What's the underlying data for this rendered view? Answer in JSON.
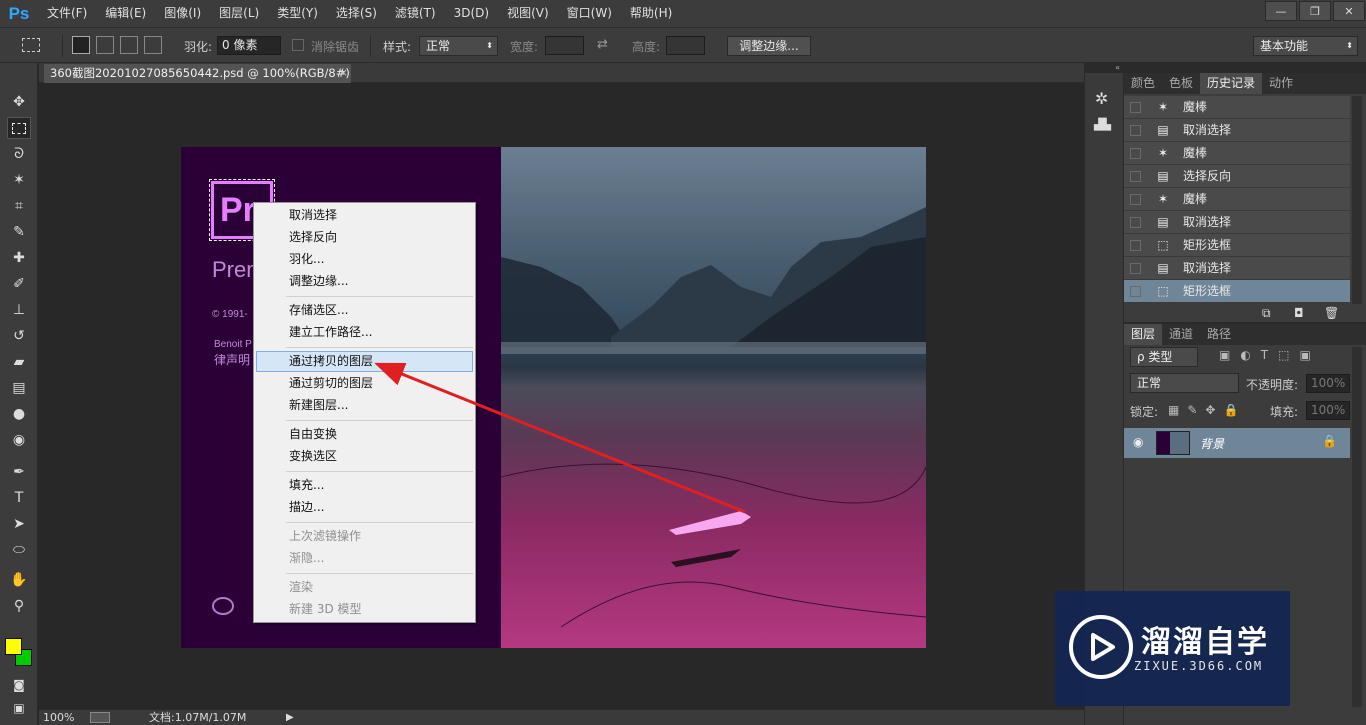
{
  "app": {
    "logo": "Ps"
  },
  "menu": [
    "文件(F)",
    "编辑(E)",
    "图像(I)",
    "图层(L)",
    "类型(Y)",
    "选择(S)",
    "滤镜(T)",
    "3D(D)",
    "视图(V)",
    "窗口(W)",
    "帮助(H)"
  ],
  "window_buttons": {
    "minimize": "—",
    "restore": "❐",
    "close": "✕"
  },
  "options": {
    "feather_label": "羽化:",
    "feather_value": "0 像素",
    "antialias_label": "消除锯齿",
    "style_label": "样式:",
    "style_value": "正常",
    "width_label": "宽度:",
    "height_label": "高度:",
    "refine_button": "调整边缘...",
    "workspace": "基本功能"
  },
  "document": {
    "tab_title": "360截图20201027085650442.psd @ 100%(RGB/8#)",
    "close": "×"
  },
  "splash": {
    "logo_text": "Pr",
    "product": "Prem",
    "copyright": "© 1991-",
    "credit1": "Benoit P",
    "credit2": "律声明"
  },
  "context_menu": {
    "items": [
      {
        "label": "取消选择",
        "disabled": false
      },
      {
        "label": "选择反向",
        "disabled": false
      },
      {
        "label": "羽化...",
        "disabled": false
      },
      {
        "label": "调整边缘...",
        "disabled": false
      },
      {
        "label": "存储选区...",
        "disabled": false
      },
      {
        "label": "建立工作路径...",
        "disabled": false
      },
      {
        "label": "通过拷贝的图层",
        "disabled": false,
        "highlight": true
      },
      {
        "label": "通过剪切的图层",
        "disabled": false
      },
      {
        "label": "新建图层...",
        "disabled": false
      },
      {
        "label": "自由变换",
        "disabled": false
      },
      {
        "label": "变换选区",
        "disabled": false
      },
      {
        "label": "填充...",
        "disabled": false
      },
      {
        "label": "描边...",
        "disabled": false
      },
      {
        "label": "上次滤镜操作",
        "disabled": true
      },
      {
        "label": "渐隐...",
        "disabled": true
      },
      {
        "label": "渲染",
        "disabled": true
      },
      {
        "label": "新建 3D 模型",
        "disabled": true
      }
    ]
  },
  "history_panel": {
    "tabs": [
      "颜色",
      "色板",
      "历史记录",
      "动作"
    ],
    "active_tab": "历史记录",
    "items": [
      {
        "icon": "magic-wand-icon",
        "label": "魔棒"
      },
      {
        "icon": "document-icon",
        "label": "取消选择"
      },
      {
        "icon": "magic-wand-icon",
        "label": "魔棒"
      },
      {
        "icon": "document-icon",
        "label": "选择反向"
      },
      {
        "icon": "magic-wand-icon",
        "label": "魔棒"
      },
      {
        "icon": "document-icon",
        "label": "取消选择"
      },
      {
        "icon": "marquee-icon",
        "label": "矩形选框"
      },
      {
        "icon": "document-icon",
        "label": "取消选择"
      },
      {
        "icon": "marquee-icon",
        "label": "矩形选框",
        "selected": true
      }
    ]
  },
  "layers_panel": {
    "tabs": [
      "图层",
      "通道",
      "路径"
    ],
    "active_tab": "图层",
    "filter_label": "ρ 类型",
    "blend_mode": "正常",
    "opacity_label": "不透明度:",
    "opacity_value": "100%",
    "lock_label": "锁定:",
    "fill_label": "填充:",
    "fill_value": "100%",
    "layer_name": "背景"
  },
  "status": {
    "zoom": "100%",
    "doc_info": "文档:1.07M/1.07M"
  },
  "watermark": {
    "title": "溜溜自学",
    "url": "ZIXUE.3D66.COM"
  },
  "colors": {
    "foreground": "#ffff00",
    "background": "#00cc00",
    "arrow": "#e02020"
  }
}
